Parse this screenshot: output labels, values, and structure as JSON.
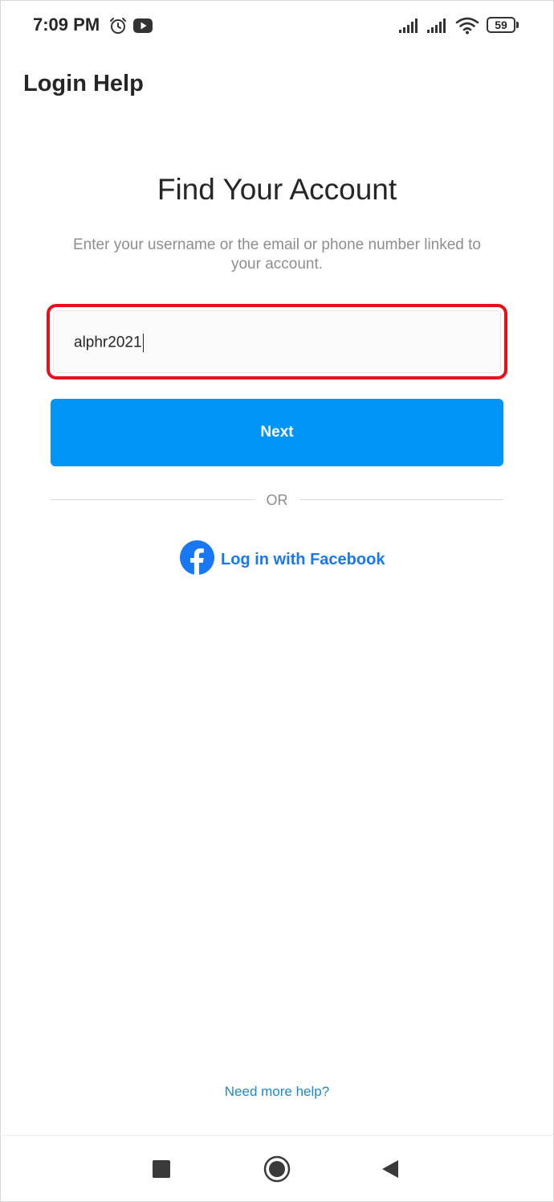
{
  "status_bar": {
    "time": "7:09 PM",
    "battery_level": "59",
    "icons": [
      "alarm-icon",
      "youtube-icon",
      "signal-icon",
      "signal-icon",
      "wifi-icon",
      "battery-icon"
    ]
  },
  "header": {
    "title": "Login Help"
  },
  "main": {
    "heading": "Find Your Account",
    "subtext": "Enter your username or the email or phone number linked to your account.",
    "username_input": {
      "value": "alphr2021"
    },
    "next_label": "Next",
    "divider_label": "OR",
    "facebook_label": "Log in with Facebook"
  },
  "footer": {
    "help_label": "Need more help?"
  },
  "nav_bar": {
    "buttons": [
      "recents-button",
      "home-button",
      "back-button"
    ]
  },
  "colors": {
    "primary_blue": "#0095f6",
    "facebook_blue": "#1877f2",
    "highlight_red": "#e8101c"
  }
}
